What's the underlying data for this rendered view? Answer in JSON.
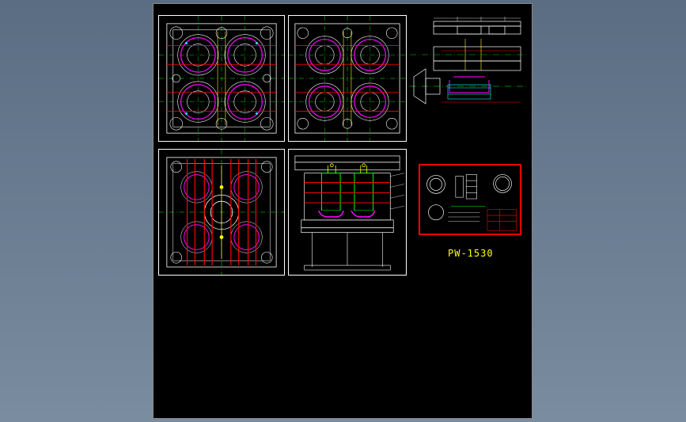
{
  "drawing": {
    "partNumber": "PW-1530",
    "views": {
      "topLeft": {
        "type": "plan-view-a",
        "cavities": 4
      },
      "topMiddle": {
        "type": "plan-view-b",
        "cavities": 4
      },
      "topRight": {
        "type": "section-side"
      },
      "bottomLeft": {
        "type": "ejector-plan",
        "cavities": 5
      },
      "bottomMiddle": {
        "type": "section-front"
      },
      "titleBlock": {
        "type": "detail-sheet"
      }
    },
    "colors": {
      "outline": "#ffffff",
      "cavity": "#ff00ff",
      "centerline": "#00ff00",
      "cooling": "#ff0000",
      "ejector": "#ffff00",
      "hidden": "#00ffff",
      "blue": "#3080ff"
    }
  }
}
